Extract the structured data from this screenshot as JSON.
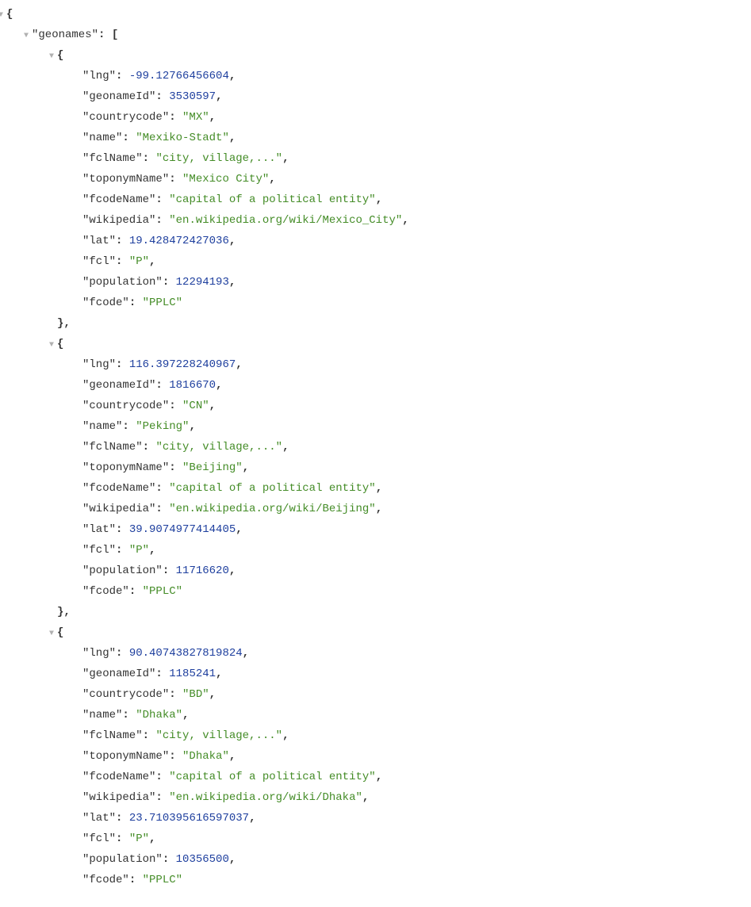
{
  "rootKey": "geonames",
  "entries": [
    {
      "lng": -99.12766456604,
      "geonameId": 3530597,
      "countrycode": "MX",
      "name": "Mexiko-Stadt",
      "fclName": "city, village,...",
      "toponymName": "Mexico City",
      "fcodeName": "capital of a political entity",
      "wikipedia": "en.wikipedia.org/wiki/Mexico_City",
      "lat": 19.428472427036,
      "fcl": "P",
      "population": 12294193,
      "fcode": "PPLC"
    },
    {
      "lng": 116.397228240967,
      "geonameId": 1816670,
      "countrycode": "CN",
      "name": "Peking",
      "fclName": "city, village,...",
      "toponymName": "Beijing",
      "fcodeName": "capital of a political entity",
      "wikipedia": "en.wikipedia.org/wiki/Beijing",
      "lat": 39.9074977414405,
      "fcl": "P",
      "population": 11716620,
      "fcode": "PPLC"
    },
    {
      "lng": 90.40743827819824,
      "geonameId": 1185241,
      "countrycode": "BD",
      "name": "Dhaka",
      "fclName": "city, village,...",
      "toponymName": "Dhaka",
      "fcodeName": "capital of a political entity",
      "wikipedia": "en.wikipedia.org/wiki/Dhaka",
      "lat": 23.710395616597037,
      "fcl": "P",
      "population": 10356500,
      "fcode": "PPLC"
    }
  ],
  "fieldOrder": [
    "lng",
    "geonameId",
    "countrycode",
    "name",
    "fclName",
    "toponymName",
    "fcodeName",
    "wikipedia",
    "lat",
    "fcl",
    "population",
    "fcode"
  ],
  "closers": [
    "},",
    "},"
  ]
}
